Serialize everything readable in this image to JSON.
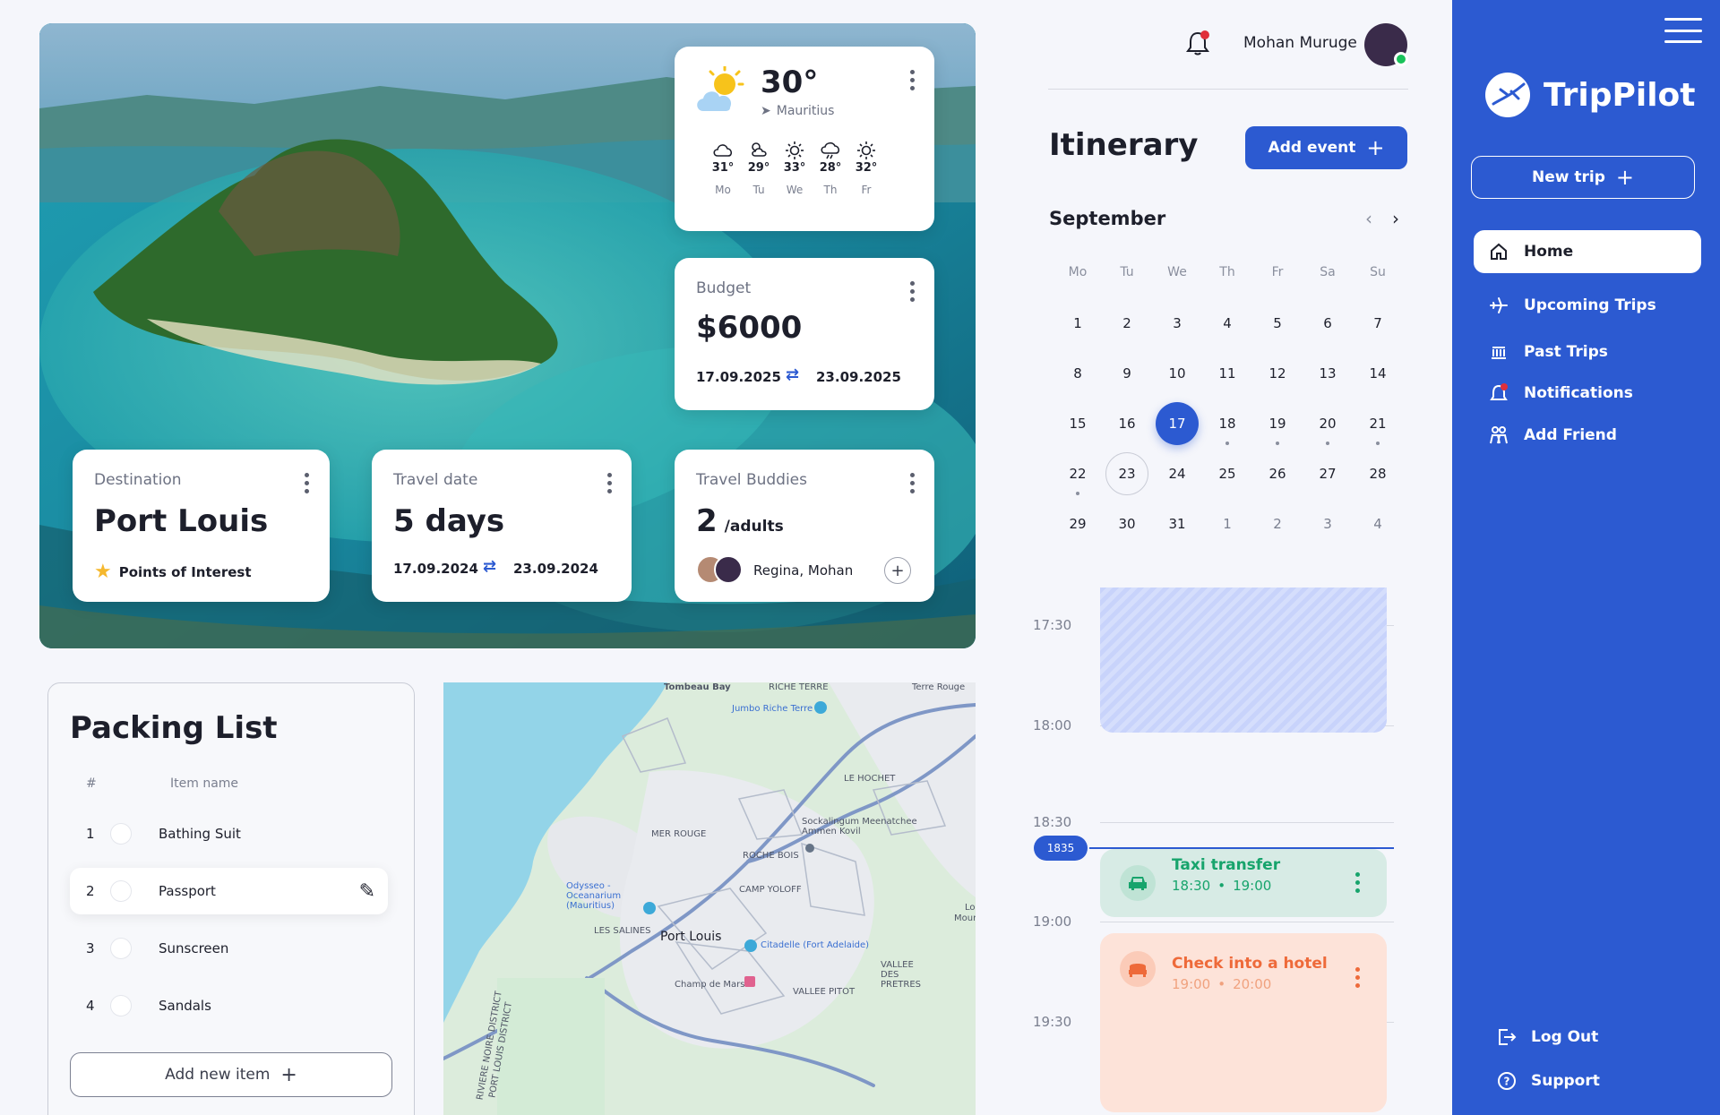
{
  "colors": {
    "accent": "#2c5ad1",
    "sidebar": "#2c5ad1",
    "taxi": "#17a46c",
    "hotel": "#ee6a3a"
  },
  "weather": {
    "temp": "30°",
    "location": "Mauritius",
    "days": [
      {
        "icon": "cloud-icon",
        "temp": "31°",
        "day": "Mo"
      },
      {
        "icon": "partly-cloudy-icon",
        "temp": "29°",
        "day": "Tu"
      },
      {
        "icon": "sun-icon",
        "temp": "33°",
        "day": "We"
      },
      {
        "icon": "cloud-rain-icon",
        "temp": "28°",
        "day": "Th"
      },
      {
        "icon": "sun-icon",
        "temp": "32°",
        "day": "Fr"
      }
    ]
  },
  "budget": {
    "label": "Budget",
    "amount": "$6000",
    "start": "17.09.2025",
    "end": "23.09.2025"
  },
  "destination": {
    "label": "Destination",
    "name": "Port Louis",
    "poi": "Points of Interest"
  },
  "travel": {
    "label": "Travel date",
    "days": "5 days",
    "start": "17.09.2024",
    "end": "23.09.2024"
  },
  "buddies": {
    "label": "Travel Buddies",
    "count": "2",
    "unit": "/adults",
    "names": "Regina, Mohan"
  },
  "packing": {
    "title": "Packing List",
    "col_num": "#",
    "col_name": "Item name",
    "items": [
      {
        "num": "1",
        "name": "Bathing Suit"
      },
      {
        "num": "2",
        "name": "Passport"
      },
      {
        "num": "3",
        "name": "Sunscreen"
      },
      {
        "num": "4",
        "name": "Sandals"
      }
    ],
    "add_label": "Add new item"
  },
  "map": {
    "labels": {
      "tombeau": "Tombeau Bay",
      "riche_terre": "RICHE TERRE",
      "jumbo": "Jumbo Riche Terre",
      "terre_rouge": "Terre Rouge",
      "le_hochet": "LE HOCHET",
      "mer_rouge": "MER ROUGE",
      "sockalingum": "Sockalingum Meenatchee Ammen Kovil",
      "roche_bois": "ROCHE BOIS",
      "odysseo": "Odysseo - Oceanarium (Mauritius)",
      "camp_yoloff": "CAMP YOLOFF",
      "les_salines": "LES SALINES",
      "port_louis": "Port Louis",
      "citadelle": "Citadelle (Fort Adelaide)",
      "champ": "Champ de Mars",
      "vallee_pitot": "VALLEE PITOT",
      "vallee_pretres": "VALLEE DES PRETRES",
      "riviere_noire": "RIVIERE NOIRE DISTRICT",
      "pl_district": "PORT LOUIS DISTRICT",
      "lo": "Lo",
      "mour": "Mour"
    }
  },
  "header": {
    "user_name": "Mohan Muruge"
  },
  "itinerary": {
    "title": "Itinerary",
    "add_event": "Add event",
    "month": "September",
    "weekdays": [
      "Mo",
      "Tu",
      "We",
      "Th",
      "Fr",
      "Sa",
      "Su"
    ],
    "weeks": [
      [
        "1",
        "2",
        "3",
        "4",
        "5",
        "6",
        "7"
      ],
      [
        "8",
        "9",
        "10",
        "11",
        "12",
        "13",
        "14"
      ],
      [
        "15",
        "16",
        "17",
        "18",
        "19",
        "20",
        "21"
      ],
      [
        "22",
        "23",
        "24",
        "25",
        "26",
        "27",
        "28"
      ],
      [
        "29",
        "30",
        "31",
        "1",
        "2",
        "3",
        "4"
      ]
    ],
    "selected_day": "17",
    "ringed_day": "23",
    "times": [
      "17:30",
      "18:00",
      "18:30",
      "19:00",
      "19:30"
    ],
    "now": "1835",
    "events": [
      {
        "title": "Taxi transfer",
        "start": "18:30",
        "end": "19:00"
      },
      {
        "title": "Check into a hotel",
        "start": "19:00",
        "end": "20:00"
      }
    ]
  },
  "sidebar": {
    "brand": "TripPilot",
    "new_trip": "New trip",
    "items": [
      {
        "label": "Home"
      },
      {
        "label": "Upcoming Trips"
      },
      {
        "label": "Past Trips"
      },
      {
        "label": "Notifications"
      },
      {
        "label": "Add Friend"
      }
    ],
    "logout": "Log Out",
    "support": "Support"
  }
}
